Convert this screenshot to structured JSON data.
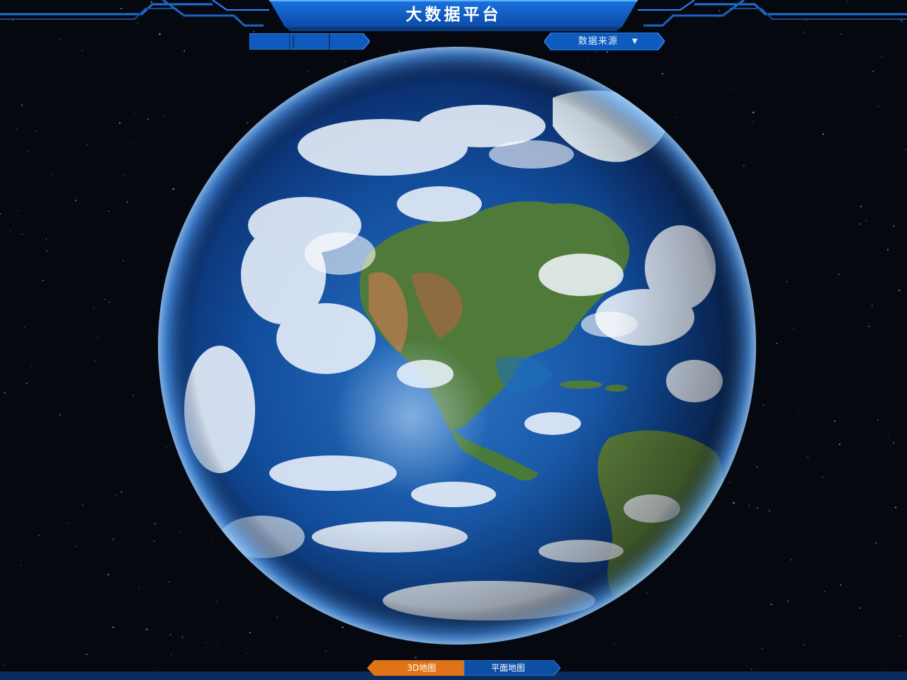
{
  "header": {
    "title": "大数据平台",
    "accent_color": "#1466d2",
    "bar_color": "#0a3a7a"
  },
  "toolbar": {
    "tab_count": 3,
    "data_source": {
      "label": "数据来源",
      "caret": "▼"
    }
  },
  "map_view": {
    "options": [
      "3D地图",
      "平面地图"
    ],
    "active": "3D地图",
    "active_color": "#e07317",
    "inactive_color": "#0d4fa3"
  },
  "icons": [
    "chevron-down-icon",
    "globe-image"
  ]
}
